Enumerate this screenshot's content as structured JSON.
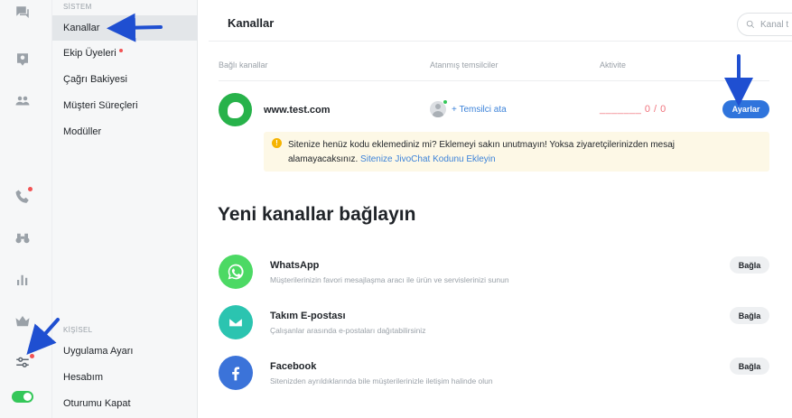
{
  "menu": {
    "section_system": "SİSTEM",
    "section_personal": "KİŞİSEL",
    "items": [
      {
        "label": "Kanallar"
      },
      {
        "label": "Ekip Üyeleri"
      },
      {
        "label": "Çağrı Bakiyesi"
      },
      {
        "label": "Müşteri Süreçleri"
      },
      {
        "label": "Modüller"
      }
    ],
    "personal_items": [
      {
        "label": "Uygulama Ayarı"
      },
      {
        "label": "Hesabım"
      },
      {
        "label": "Oturumu Kapat"
      }
    ]
  },
  "header": {
    "title": "Kanallar",
    "search_placeholder": "Kanal t"
  },
  "connected": {
    "col_channels": "Bağlı kanallar",
    "col_agents": "Atanmış temsilciler",
    "col_activity": "Aktivite",
    "channel_name": "www.test.com",
    "assign_label": "+ Temsilci ata",
    "activity_value": "_______ 0 / 0",
    "settings_button": "Ayarlar",
    "warning_text": "Sitenize henüz kodu eklemediniz mi? Eklemeyi sakın unutmayın! Yoksa ziyaretçilerinizden mesaj alamayacaksınız.",
    "warning_link": "Sitenize JivoChat Kodunu Ekleyin"
  },
  "new_channels": {
    "title": "Yeni kanallar bağlayın",
    "items": [
      {
        "name": "WhatsApp",
        "desc": "Müşterilerinizin favori mesajlaşma aracı ile ürün ve servislerinizi sunun",
        "button": "Bağla",
        "color": "#4cd964",
        "icon": "whatsapp-icon"
      },
      {
        "name": "Takım E-postası",
        "desc": "Çalışanlar arasında e-postaları dağıtabilirsiniz",
        "button": "Bağla",
        "color": "#2bc4b0",
        "icon": "mail-icon"
      },
      {
        "name": "Facebook",
        "desc": "Sitenizden ayrıldıklarında bile müşterilerinizle iletişim halinde olun",
        "button": "Bağla",
        "color": "#3b73d9",
        "icon": "facebook-icon"
      }
    ]
  },
  "colors": {
    "accent": "#2f74dc",
    "link": "#3d83d9",
    "alert_dot": "#f25354",
    "online": "#34c759",
    "annotation_arrow": "#1f4fd1"
  }
}
